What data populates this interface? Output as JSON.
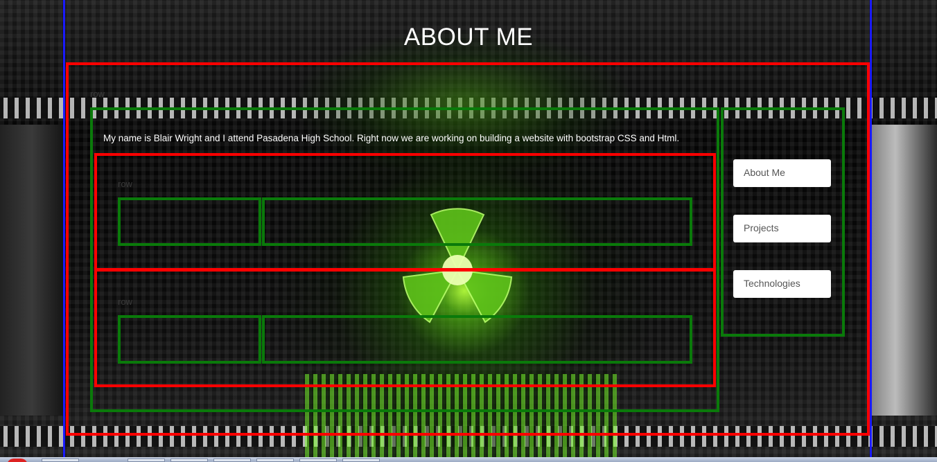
{
  "page": {
    "title": "ABOUT ME",
    "intro": "My name is Blair Wright and I attend Pasadena High School. Right now we are working on building a website with bootstrap CSS and Html."
  },
  "rows": {
    "outer_label": "row",
    "row1_label": "row",
    "row2_label": "row"
  },
  "nav": {
    "items": [
      {
        "label": "About Me"
      },
      {
        "label": "Projects"
      },
      {
        "label": "Technologies"
      }
    ]
  },
  "colors": {
    "container_outline": "#1a1aff",
    "row_outline": "#ff0000",
    "column_outline": "#0a7a0a",
    "accent_glow": "#8cff32"
  },
  "icons": {
    "background_emblem": "radiation-icon"
  }
}
